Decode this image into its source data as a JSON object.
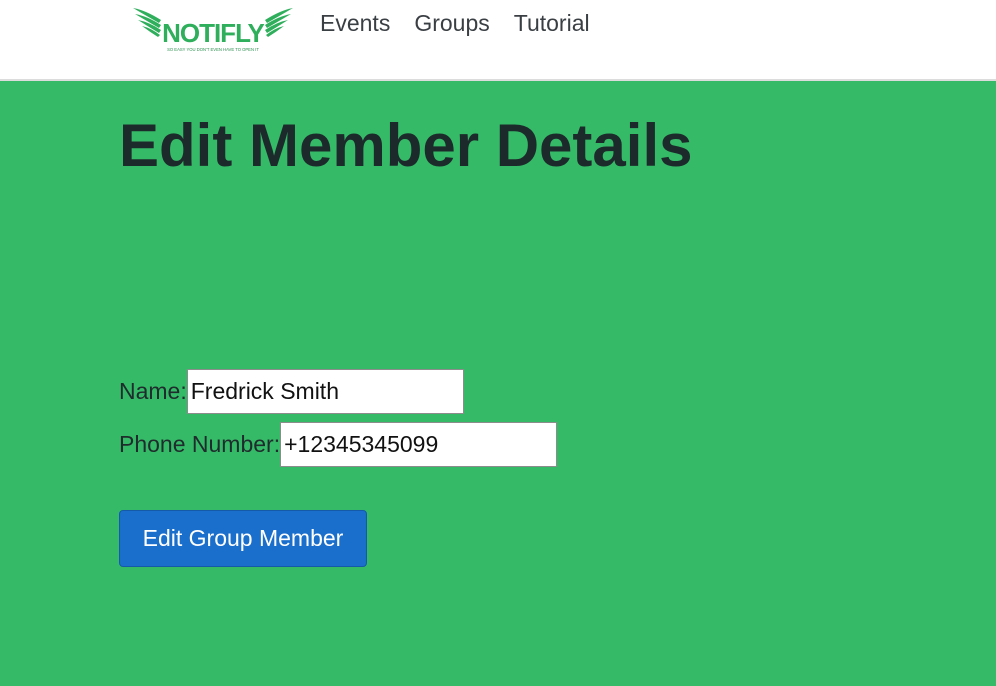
{
  "navbar": {
    "brand": {
      "name": "NOTIFLY",
      "tagline": "SO EASY YOU DON'T EVEN HAVE TO OPEN IT",
      "color": "#2fae5c"
    },
    "links": [
      {
        "label": "Events"
      },
      {
        "label": "Groups"
      },
      {
        "label": "Tutorial"
      }
    ]
  },
  "page": {
    "title": "Edit Member Details",
    "background_color": "#35bb67"
  },
  "form": {
    "name": {
      "label": "Name:",
      "value": "Fredrick Smith"
    },
    "phone": {
      "label": "Phone Number:",
      "value": "+12345345099"
    },
    "submit_label": "Edit Group Member",
    "submit_color": "#1b6fcc"
  }
}
